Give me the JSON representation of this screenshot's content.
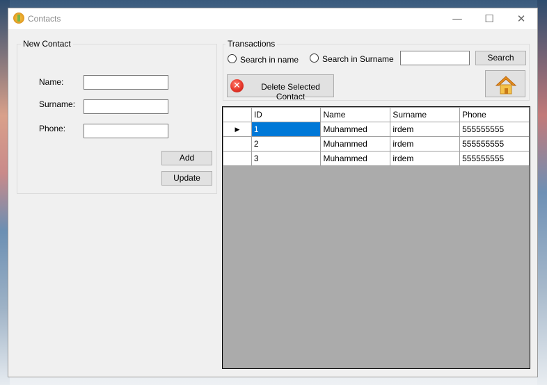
{
  "window": {
    "title": "Contacts",
    "controls": {
      "minimize": "—",
      "maximize": "☐",
      "close": "✕"
    }
  },
  "new_contact": {
    "legend": "New Contact",
    "fields": {
      "name": {
        "label": "Name:",
        "value": ""
      },
      "surname": {
        "label": "Surname:",
        "value": ""
      },
      "phone": {
        "label": "Phone:",
        "value": ""
      }
    },
    "add_label": "Add",
    "update_label": "Update"
  },
  "transactions": {
    "legend": "Transactions",
    "search_in_name_label": "Search in name",
    "search_in_surname_label": "Search in Surname",
    "search_value": "",
    "search_button_label": "Search",
    "delete_button_label": "Delete Selected Contact",
    "delete_icon": "✕",
    "home_icon": "home-icon"
  },
  "grid": {
    "columns": [
      "ID",
      "Name",
      "Surname",
      "Phone"
    ],
    "rows": [
      {
        "id": "1",
        "name": "Muhammed",
        "surname": "irdem",
        "phone": "555555555",
        "selected": true
      },
      {
        "id": "2",
        "name": "Muhammed",
        "surname": "irdem",
        "phone": "555555555",
        "selected": false
      },
      {
        "id": "3",
        "name": "Muhammed",
        "surname": "irdem",
        "phone": "555555555",
        "selected": false
      }
    ],
    "current_row_marker": "▶"
  },
  "colors": {
    "selection": "#0078d7",
    "form_background": "#f0f0f0",
    "grid_background": "#ababab"
  }
}
